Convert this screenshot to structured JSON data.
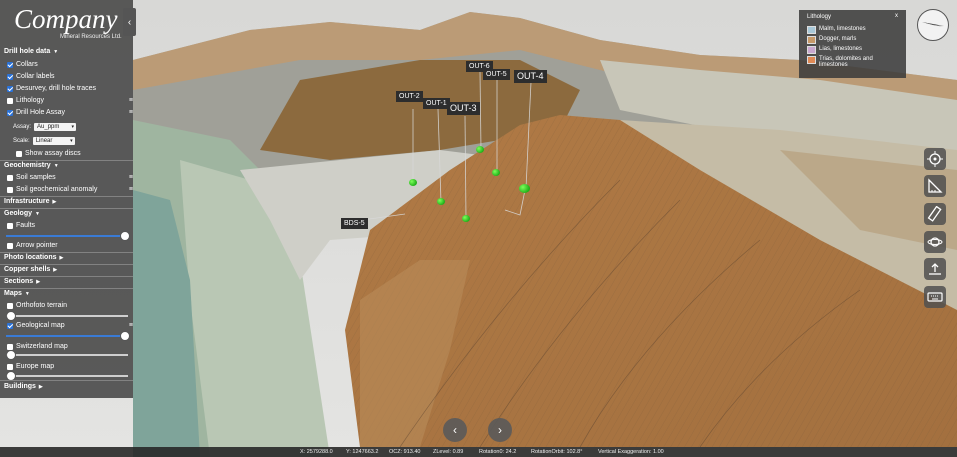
{
  "brand": {
    "name": "Company",
    "subtitle": "Mineral Resources Ltd."
  },
  "panel": {
    "collapse_icon": "chevron-left-icon",
    "sections": {
      "drill": "Drill hole data",
      "geochem": "Geochemistry",
      "infra": "Infrastructure",
      "geology": "Geology",
      "photo": "Photo locations",
      "copper": "Copper shells",
      "sections": "Sections",
      "maps": "Maps",
      "buildings": "Buildings"
    },
    "items": {
      "collars": "Collars",
      "collar_labels": "Collar labels",
      "desurvey": "Desurvey, drill hole traces",
      "lithology": "Lithology",
      "assay": "Drill Hole Assay",
      "assay_label": "Assay:",
      "assay_value": "Au_ppm",
      "scale_label": "Scale:",
      "scale_value": "Linear",
      "show_discs": "Show assay discs",
      "soil_samples": "Soil samples",
      "soil_anomaly": "Soil geochemical anomaly",
      "faults": "Faults",
      "arrow_pointer": "Arrow pointer",
      "orthophoto": "Orthofoto terrain",
      "geo_map": "Geological map",
      "switzerland": "Switzerland map",
      "europe": "Europe map"
    },
    "sliders": {
      "faults": 1.0,
      "orthophoto": 0.0,
      "geo_map": 1.0,
      "europe": 0.0
    }
  },
  "legend": {
    "title": "Lithology",
    "close": "x",
    "entries": [
      {
        "label": "Malm, limestones",
        "color": "#a8c8d8"
      },
      {
        "label": "Dogger, marls",
        "color": "#c79a6a"
      },
      {
        "label": "Lias, limestones",
        "color": "#c9a8d0"
      },
      {
        "label": "Trias, dolomites and limestones",
        "color": "#e08a56"
      }
    ]
  },
  "labels": {
    "out2": "OUT-2",
    "out1": "OUT-1",
    "out3": "OUT-3",
    "out6": "OUT-6",
    "out5": "OUT-5",
    "out4": "OUT-4",
    "bds5": "BDS-5"
  },
  "status": {
    "x": "X: 2579288.0",
    "y": "Y: 1247663.2",
    "ocz": "OCZ: 913.40",
    "zlevel": "ZLevel: 0.89",
    "rotation": "Rotation0: 24.2",
    "orbit": "RotationOrbit: 102.8°",
    "exaggeration": "Vertical Exaggeration: 1.00"
  },
  "nav": {
    "prev": "‹",
    "next": "›"
  },
  "tools": [
    "target-icon",
    "ruler-icon",
    "measure-icon",
    "orbit-icon",
    "upload-icon",
    "keyboard-icon"
  ]
}
